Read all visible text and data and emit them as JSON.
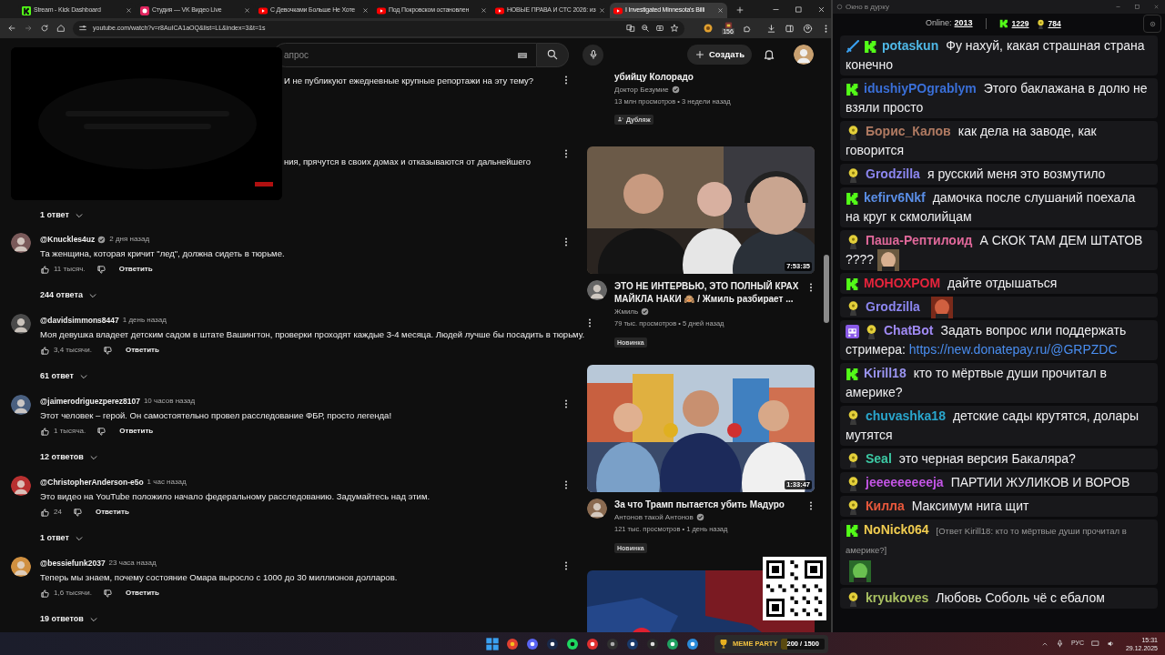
{
  "browser": {
    "tabs": [
      {
        "title": "Stream - Kick Dashboard",
        "kind": "kick",
        "selected": false
      },
      {
        "title": "Студия — VK Видео Live",
        "kind": "vk",
        "selected": false
      },
      {
        "title": "С Девочками Больше Не Хоте",
        "kind": "youtube",
        "selected": false
      },
      {
        "title": "Под Покровском остановлен",
        "kind": "youtube",
        "selected": false
      },
      {
        "title": "НОВЫЕ ПРАВА И СТС 2026: из",
        "kind": "youtube",
        "selected": false
      },
      {
        "title": "I Investigated Minnesota's Billi",
        "kind": "youtube",
        "selected": true
      }
    ],
    "url": "youtube.com/watch?v=r8AuICA1aOQ&list=LL&index=3&t=1s",
    "extension_badge": "156"
  },
  "youtube": {
    "search": {
      "placeholder": "апрос"
    },
    "create_label": "Создать",
    "covered_fragments": [
      "И не публикуют ежедневные крупные репортажи на эту тему?",
      "ния, прячутся в своих домах и отказываются от дальнейшего"
    ],
    "top_replies": "1 ответ",
    "comments": [
      {
        "author": "@Knuckles4uz",
        "verified": true,
        "time": "2 дня назад",
        "text": "Та женщина, которая кричит \"лед\", должна сидеть в тюрьме.",
        "likes": "11 тысяч.",
        "reply": "Ответить",
        "replies": "244 ответа"
      },
      {
        "author": "@davidsimmons8447",
        "verified": false,
        "time": "1 день назад",
        "text": "Моя девушка владеет детским садом в штате Вашингтон, проверки проходят каждые 3-4 месяца. Людей лучше бы посадить в тюрьму.",
        "likes": "3,4 тысячи.",
        "reply": "Ответить",
        "replies": "61 ответ"
      },
      {
        "author": "@jaimerodriguezperez8107",
        "verified": false,
        "time": "10 часов назад",
        "text": "Этот человек – герой. Он самостоятельно провел расследование ФБР, просто легенда!",
        "likes": "1 тысяча.",
        "reply": "Ответить",
        "replies": "12 ответов"
      },
      {
        "author": "@ChristopherAnderson-e5o",
        "verified": false,
        "time": "1 час назад",
        "text": "Это видео на YouTube положило начало федеральному расследованию. Задумайтесь над этим.",
        "likes": "24",
        "reply": "Ответить",
        "replies": "1 ответ"
      },
      {
        "author": "@bessiefunk2037",
        "verified": false,
        "time": "23 часа назад",
        "text": "Теперь мы знаем, почему состояние Омара выросло с 1000 до 30 миллионов долларов.",
        "likes": "1,6 тысячи.",
        "reply": "Ответить",
        "replies": "19 ответов"
      }
    ],
    "videos": [
      {
        "kind": "cut_top",
        "title": "убийцу Колорадо",
        "channel": "Доктор Безумие",
        "verified": true,
        "stats": "13 млн просмотров • 3 недели назад",
        "badge": "Дубляж",
        "badge_icon": true
      },
      {
        "kind": "full",
        "duration": "7:53:35",
        "title": "ЭТО НЕ ИНТЕРВЬЮ, ЭТО ПОЛНЫЙ КРАХ МАЙКЛА НАКИ 🙈 / Жмиль разбирает ...",
        "channel": "Жмиль",
        "verified": true,
        "stats": "79 тыс. просмотров • 5 дней назад",
        "badge": "Новинка",
        "badge_icon": false
      },
      {
        "kind": "full",
        "duration": "1:33:47",
        "title": "За что Трамп пытается убить Мадуро",
        "channel": "Антонов такой Антонов",
        "verified": true,
        "stats": "121 тыс. просмотров • 1 день назад",
        "badge": "Новинка",
        "badge_icon": false
      },
      {
        "kind": "cut_bottom"
      }
    ]
  },
  "chat": {
    "title": "Окно в дурку",
    "online_label": "Online:",
    "online": "2013",
    "kick_count": "1229",
    "rank_count": "784",
    "messages": [
      {
        "badges": [
          {
            "kind": "sword"
          },
          {
            "kind": "kick"
          }
        ],
        "user": "potaskun",
        "color": "#4fb8e6",
        "text": "Фу нахуй, какая страшная страна конечно",
        "emote": false
      },
      {
        "badges": [
          {
            "kind": "kick"
          }
        ],
        "user": "idushiyPOgrablym",
        "color": "#3a6fd8",
        "text": "Этого баклажана в долю не взяли просто",
        "emote": false
      },
      {
        "badges": [
          {
            "kind": "rank"
          }
        ],
        "user": "Борис_Калов",
        "color": "#b07a62",
        "text": "как дела на заводе, как говорится",
        "emote": false
      },
      {
        "badges": [
          {
            "kind": "rank"
          }
        ],
        "user": "Grodzilla",
        "color": "#8c86f0",
        "text": "я русский меня это возмутило",
        "emote": false
      },
      {
        "badges": [
          {
            "kind": "kick"
          }
        ],
        "user": "kefirv6Nkf",
        "color": "#5a8ee6",
        "text": "дамочка после слушаний поехала на круг к скмолийцам",
        "emote": false
      },
      {
        "badges": [
          {
            "kind": "rank"
          }
        ],
        "user": "Паша-Рептилоид",
        "color": "#e0689a",
        "text": "А СКОК ТАМ ДЕМ ШТАТОВ ????",
        "emote": true
      },
      {
        "badges": [
          {
            "kind": "kick"
          }
        ],
        "user": "МОНОХРОМ",
        "color": "#e8243c",
        "text": "дайте отдышаться",
        "emote": false
      },
      {
        "badges": [
          {
            "kind": "rank"
          }
        ],
        "user": "Grodzilla",
        "color": "#8c86f0",
        "emote": true
      },
      {
        "badges": [
          {
            "kind": "bot"
          },
          {
            "kind": "rank"
          }
        ],
        "user": "ChatBot",
        "color": "#a08af5",
        "text": "Задать вопрос или поддержать стримера:",
        "link": "https://new.donatepay.ru/@GRPZDC",
        "emote": false
      },
      {
        "badges": [
          {
            "kind": "kick"
          }
        ],
        "user": "Kirill18",
        "color": "#9a94f0",
        "text": "кто то мёртвые души прочитал в америке?",
        "emote": false
      },
      {
        "badges": [
          {
            "kind": "rank"
          }
        ],
        "user": "chuvashka18",
        "color": "#2aa6cc",
        "text": "детские сады крутятся, долары мутятся",
        "emote": false
      },
      {
        "badges": [
          {
            "kind": "rank"
          }
        ],
        "user": "Seal",
        "color": "#3cc9a4",
        "text": "это черная версия Бакаляра?",
        "emote": false
      },
      {
        "badges": [
          {
            "kind": "rank"
          }
        ],
        "user": "jeeeeeeeeeja",
        "color": "#c455e6",
        "text": "ПАРТИИ ЖУЛИКОВ И ВОРОВ",
        "emote": false
      },
      {
        "badges": [
          {
            "kind": "rank"
          }
        ],
        "user": "Килла",
        "color": "#e8583c",
        "text": "Максимум нига щит",
        "emote": false
      },
      {
        "badges": [
          {
            "kind": "kick"
          }
        ],
        "user": "NoNick064",
        "color": "#f0cc50",
        "quote": "[Ответ Kirill18: кто то мёртвые души прочитал в америке?]",
        "emote": true
      },
      {
        "badges": [
          {
            "kind": "rank"
          }
        ],
        "user": "kryukoves",
        "color": "#a9c062",
        "text": "Любовь Соболь чё с ебалом",
        "emote": false
      }
    ]
  },
  "taskbar": {
    "widget_title": "MEME PARTY",
    "widget_progress": "200 / 1500",
    "level": 0.13,
    "language": "РУС",
    "time": "15:31",
    "date": "29.12.2025"
  }
}
